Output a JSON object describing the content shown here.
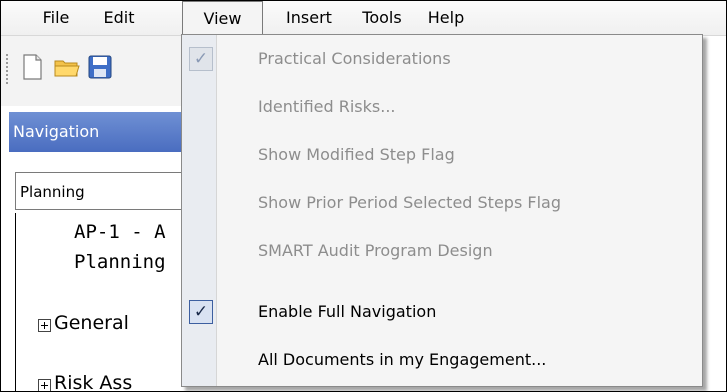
{
  "menubar": {
    "items": [
      {
        "label": "File"
      },
      {
        "label": "Edit"
      },
      {
        "label": "View",
        "active": true
      },
      {
        "label": "Insert"
      },
      {
        "label": "Tools"
      },
      {
        "label": "Help"
      }
    ]
  },
  "toolbar": {
    "icons": [
      "new-document-icon",
      "open-folder-icon",
      "save-disk-icon"
    ]
  },
  "navigation": {
    "title": "Navigation",
    "selected": "Planning",
    "tree": {
      "item1_line1": "AP-1 - A",
      "item1_line2": "Planning",
      "item2": "General",
      "item3": "Risk Ass"
    }
  },
  "view_menu": {
    "items": [
      {
        "label": "Practical Considerations",
        "enabled": false,
        "checked": true
      },
      {
        "label": "Identified Risks...",
        "enabled": false,
        "checked": false
      },
      {
        "label": "Show Modified Step Flag",
        "enabled": false,
        "checked": false
      },
      {
        "label": "Show Prior Period Selected Steps Flag",
        "enabled": false,
        "checked": false
      },
      {
        "label": "SMART Audit Program Design",
        "enabled": false,
        "checked": false
      },
      {
        "label": "Enable Full Navigation",
        "enabled": true,
        "checked": true
      },
      {
        "label": "All Documents in my Engagement...",
        "enabled": true,
        "checked": false
      }
    ]
  },
  "colors": {
    "nav_header": "#4a6dc0",
    "disabled_text": "#8d8d8d",
    "menu_bg": "#f5f5f5"
  }
}
